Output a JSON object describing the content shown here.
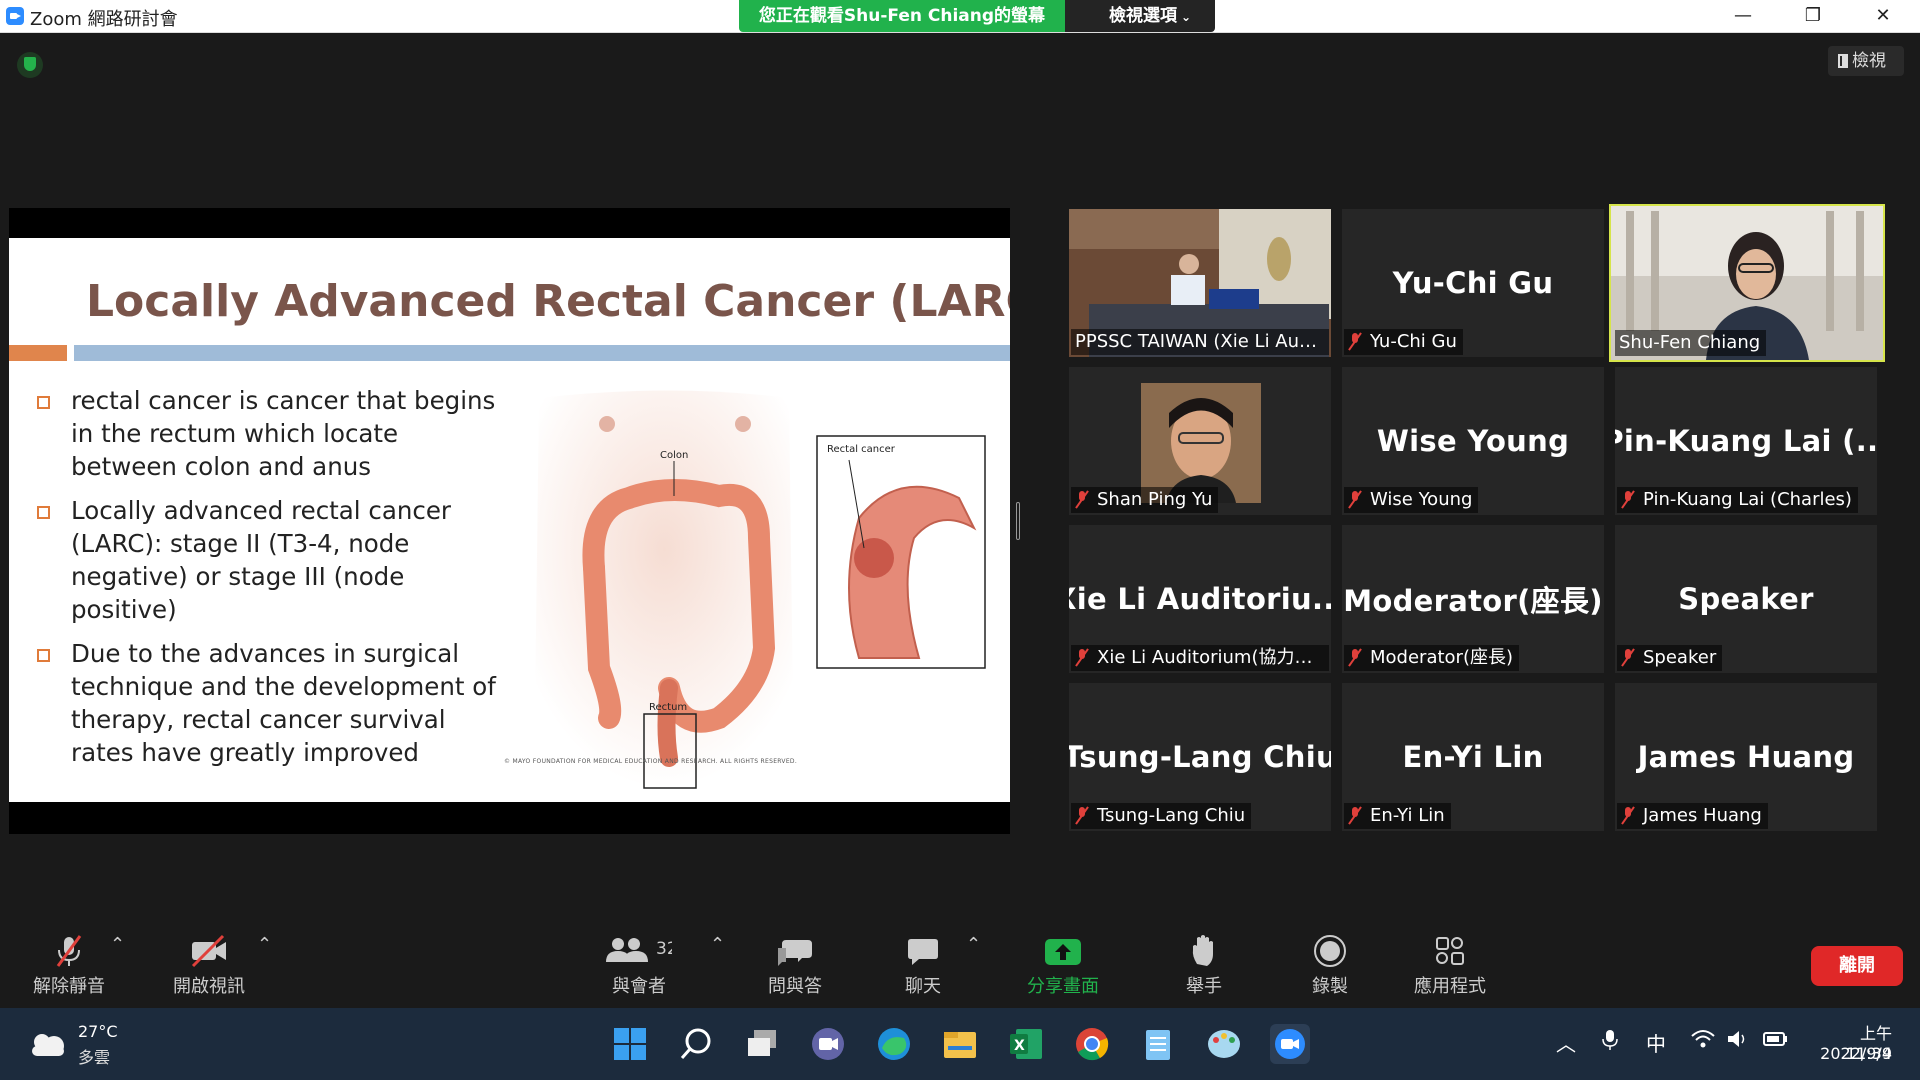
{
  "window": {
    "title": "Zoom 網路研討會",
    "viewing_banner": "您正在觀看Shu-Fen Chiang的螢幕",
    "view_options": "檢視選項",
    "view_button": "檢視",
    "controls": [
      "—",
      "❐",
      "✕"
    ]
  },
  "slide": {
    "title": "Locally Advanced Rectal Cancer (LARC)",
    "bullets": [
      "rectal cancer is cancer that begins in the rectum which locate between colon and anus",
      "Locally advanced rectal cancer (LARC): stage II (T3-4, node negative) or stage III (node positive)",
      "Due to the advances in surgical technique and the development of therapy, rectal cancer survival rates have greatly improved"
    ],
    "figure_labels": {
      "colon": "Colon",
      "rectum": "Rectum",
      "rectal_cancer": "Rectal cancer"
    },
    "copyright": "© MAYO FOUNDATION FOR MEDICAL EDUCATION AND RESEARCH. ALL RIGHTS RESERVED."
  },
  "gallery": [
    {
      "big": "",
      "label": "PPSSC TAIWAN (Xie Li Audit...",
      "muted": false,
      "video": "room"
    },
    {
      "big": "Yu-Chi Gu",
      "label": "Yu-Chi Gu",
      "muted": true
    },
    {
      "big": "",
      "label": "Shu-Fen Chiang",
      "muted": false,
      "video": "speaker",
      "active": true
    },
    {
      "big": "",
      "label": "Shan Ping Yu",
      "muted": true,
      "video": "avatar"
    },
    {
      "big": "Wise Young",
      "label": "Wise Young",
      "muted": true
    },
    {
      "big": "Pin-Kuang Lai (...",
      "label": "Pin-Kuang Lai (Charles)",
      "muted": true
    },
    {
      "big": "Xie Li Auditoriu...",
      "label": "Xie Li Auditorium(協力講...",
      "muted": true
    },
    {
      "big": "Moderator(座長)",
      "label": "Moderator(座長)",
      "muted": true
    },
    {
      "big": "Speaker",
      "label": "Speaker",
      "muted": true
    },
    {
      "big": "Tsung-Lang Chiu",
      "label": "Tsung-Lang Chiu",
      "muted": true
    },
    {
      "big": "En-Yi Lin",
      "label": "En-Yi Lin",
      "muted": true
    },
    {
      "big": "James Huang",
      "label": "James Huang",
      "muted": true
    }
  ],
  "toolbar": {
    "unmute": "解除靜音",
    "start_video": "開啟視訊",
    "participants": "與會者",
    "participant_count": "32",
    "qa": "問與答",
    "chat": "聊天",
    "share": "分享畫面",
    "raise_hand": "舉手",
    "record": "錄製",
    "apps": "應用程式",
    "leave": "離開"
  },
  "taskbar": {
    "weather_temp": "27°C",
    "weather_desc": "多雲",
    "ime": "中",
    "time": "上午 11:39",
    "date": "2022/9/4"
  },
  "colors": {
    "accent_green": "#21b24c",
    "leave_red": "#e02828",
    "active_speaker": "#d6e54a",
    "slide_title": "#7a554b"
  }
}
